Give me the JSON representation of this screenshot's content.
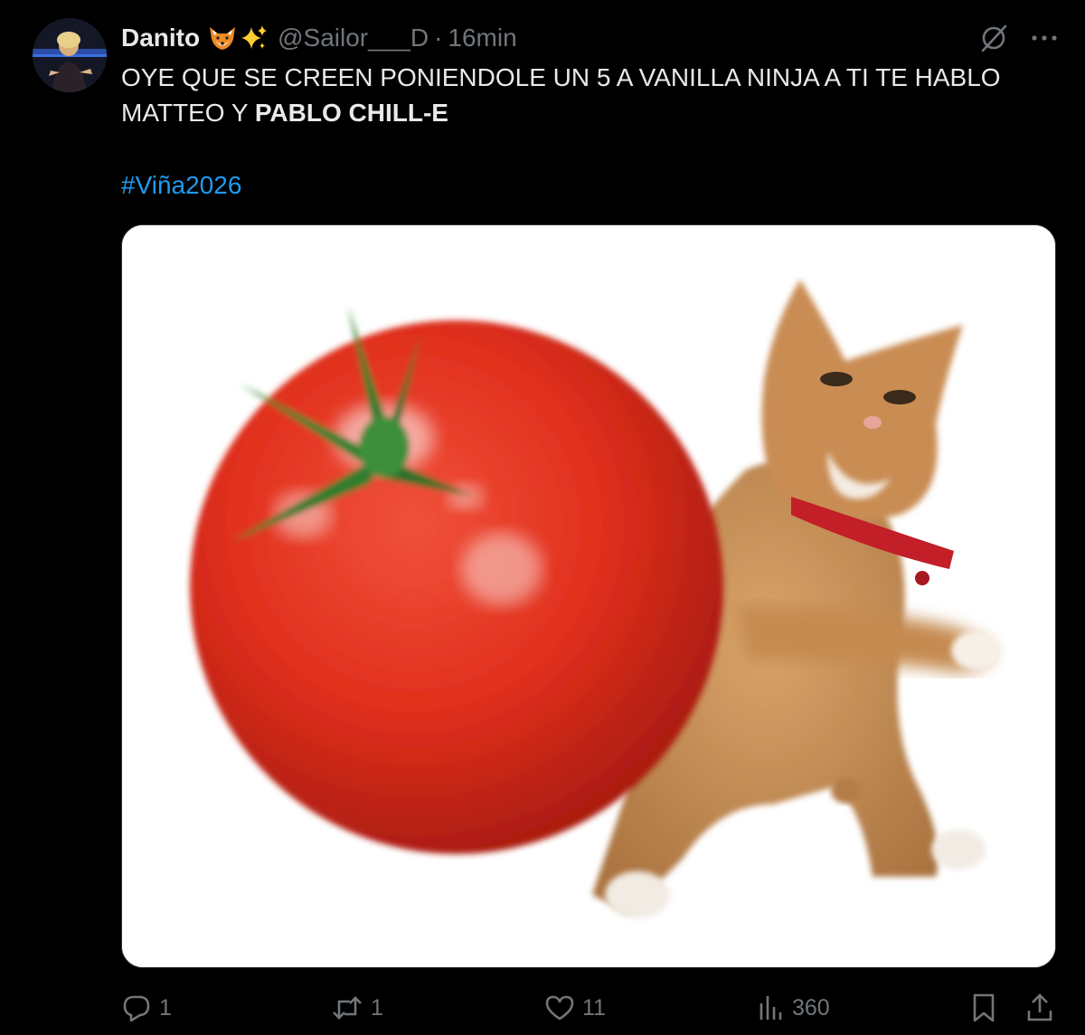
{
  "author": {
    "display_name": "Danito",
    "badge_icons": [
      "fox-emoji",
      "sparkles-emoji"
    ],
    "handle": "@Sailor___D",
    "separator": "·",
    "time": "16min"
  },
  "tweet": {
    "text_plain": "OYE QUE SE CREEN PONIENDOLE UN 5 A VANILLA NINJA A TI TE HABLO MATTEO Y ",
    "text_bold": "PABLO CHILL-E",
    "hashtag": "#Viña2026"
  },
  "media": {
    "image_description": "cat-throwing-tomato-meme"
  },
  "actions": {
    "reply_count": "1",
    "retweet_count": "1",
    "like_count": "11",
    "view_count": "360"
  },
  "colors": {
    "background": "#000000",
    "text": "#e7e9ea",
    "secondary": "#71767b",
    "link": "#1d9bf0"
  }
}
